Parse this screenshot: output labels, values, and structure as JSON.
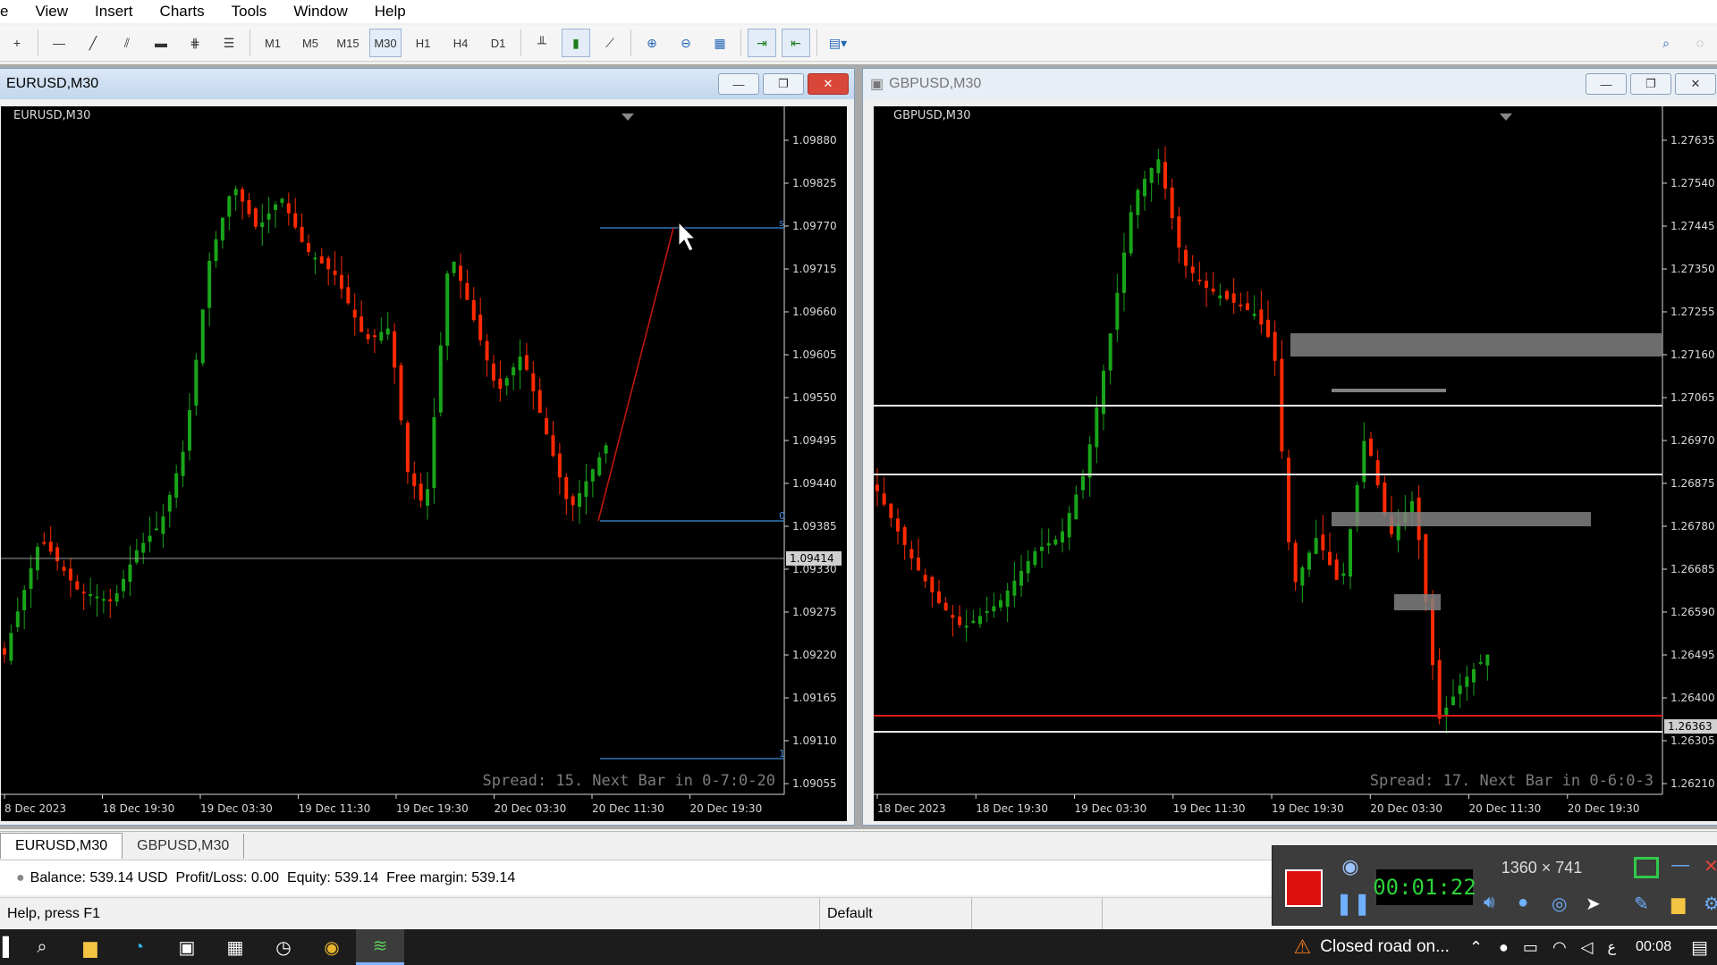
{
  "menu": [
    "e",
    "View",
    "Insert",
    "Charts",
    "Tools",
    "Window",
    "Help"
  ],
  "toolbar": {
    "timeframes": [
      "M1",
      "M5",
      "M15",
      "M30",
      "H1",
      "H4",
      "D1"
    ],
    "active_timeframe": "M30"
  },
  "windows": [
    {
      "title": "EURUSD,M30",
      "chart_label": "EURUSD,M30",
      "spread_text": "Spread: 15. Next Bar in 0-7:0-20",
      "current_price": "1.09414",
      "price_labels": [
        "1.09880",
        "1.09825",
        "1.09770",
        "1.09715",
        "1.09660",
        "1.09605",
        "1.09550",
        "1.09495",
        "1.09440",
        "1.09385",
        "1.09330",
        "1.09275",
        "1.09220",
        "1.09165",
        "1.09110",
        "1.09055"
      ],
      "time_labels": [
        "8 Dec 2023",
        "18 Dec 19:30",
        "19 Dec 03:30",
        "19 Dec 11:30",
        "19 Dec 19:30",
        "20 Dec 03:30",
        "20 Dec 11:30",
        "20 Dec 19:30"
      ],
      "fib_labels": [
        "s",
        "0",
        "1"
      ]
    },
    {
      "title": "GBPUSD,M30",
      "chart_label": "GBPUSD,M30",
      "spread_text": "Spread: 17. Next Bar in 0-6:0-3",
      "current_price": "1.26363",
      "price_labels": [
        "1.27635",
        "1.27540",
        "1.27445",
        "1.27350",
        "1.27255",
        "1.27160",
        "1.27065",
        "1.26970",
        "1.26875",
        "1.26780",
        "1.26685",
        "1.26590",
        "1.26495",
        "1.26400",
        "1.26305",
        "1.26210"
      ],
      "time_labels": [
        "18 Dec 2023",
        "18 Dec 19:30",
        "19 Dec 03:30",
        "19 Dec 11:30",
        "19 Dec 19:30",
        "20 Dec 03:30",
        "20 Dec 11:30",
        "20 Dec 19:30"
      ]
    }
  ],
  "tabs": [
    "EURUSD,M30",
    "GBPUSD,M30"
  ],
  "account_line": "Balance: 539.14 USD  Profit/Loss: 0.00  Equity: 539.14  Free margin: 539.14",
  "status": {
    "help": "Help, press F1",
    "profile": "Default"
  },
  "recorder": {
    "timer": "00:01:22",
    "resolution": "1360 × 741"
  },
  "taskbar": {
    "notification": "Closed road on...",
    "clock": "00:08"
  },
  "colors": {
    "bull": "#19a519",
    "bear": "#ff2a00",
    "chart_bg": "#000000",
    "fib": "#3f8edc",
    "grey_zone": "#808080"
  }
}
